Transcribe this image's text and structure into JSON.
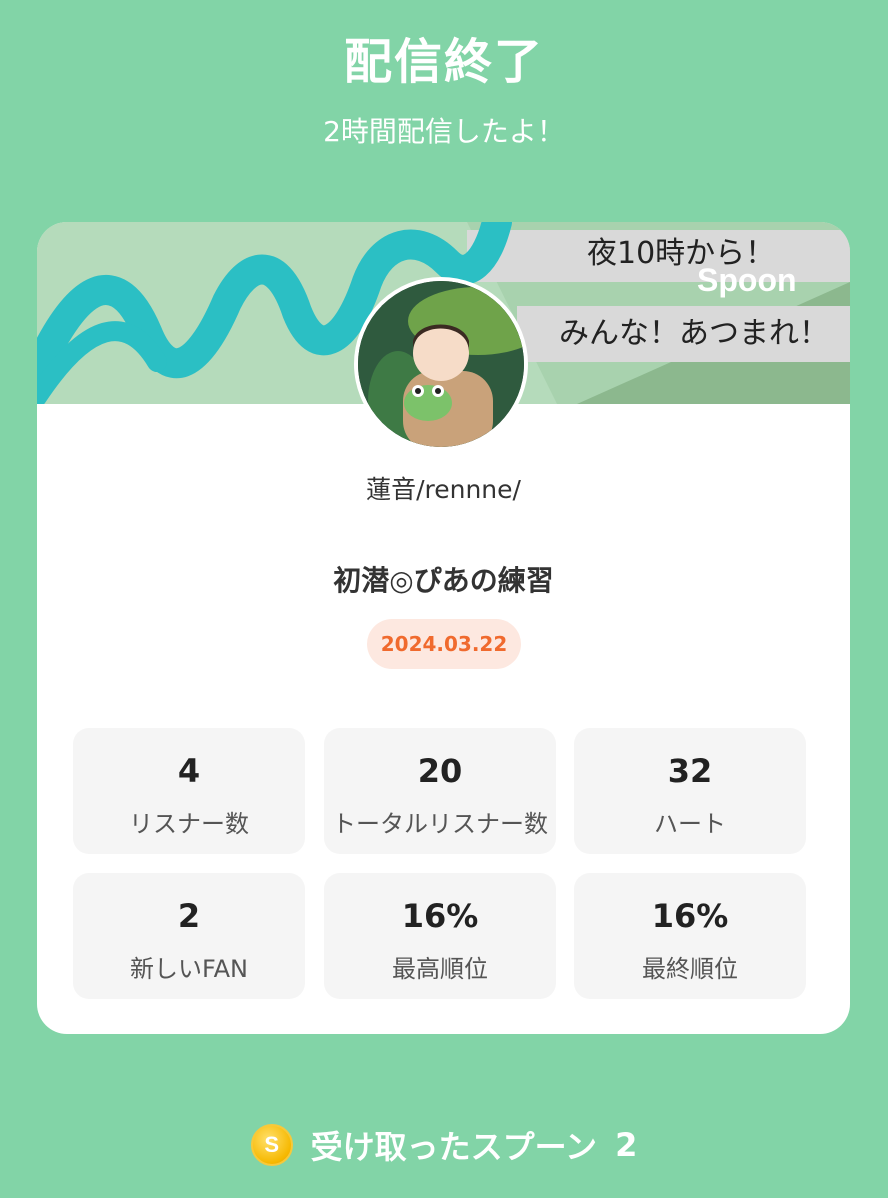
{
  "header": {
    "title": "配信終了",
    "subtitle": "2時間配信したよ！"
  },
  "banner": {
    "line1": "夜10時から！",
    "brand": "Spoon",
    "line2": "みんな！あつまれ！"
  },
  "profile": {
    "username": "蓮音/rennne/"
  },
  "live": {
    "title": "初潜◎ぴあの練習",
    "date": "2024.03.22"
  },
  "stats": [
    {
      "value": "4",
      "label": "リスナー数"
    },
    {
      "value": "20",
      "label": "トータルリスナー数"
    },
    {
      "value": "32",
      "label": "ハート"
    },
    {
      "value": "2",
      "label": "新しいFAN"
    },
    {
      "value": "16%",
      "label": "最高順位"
    },
    {
      "value": "16%",
      "label": "最終順位"
    }
  ],
  "spoons": {
    "coin_symbol": "S",
    "label": "受け取ったスプーン",
    "count": "2"
  },
  "colors": {
    "background": "#82d4a7",
    "accent": "#f06a2e",
    "badge_bg": "#fde8e0"
  }
}
